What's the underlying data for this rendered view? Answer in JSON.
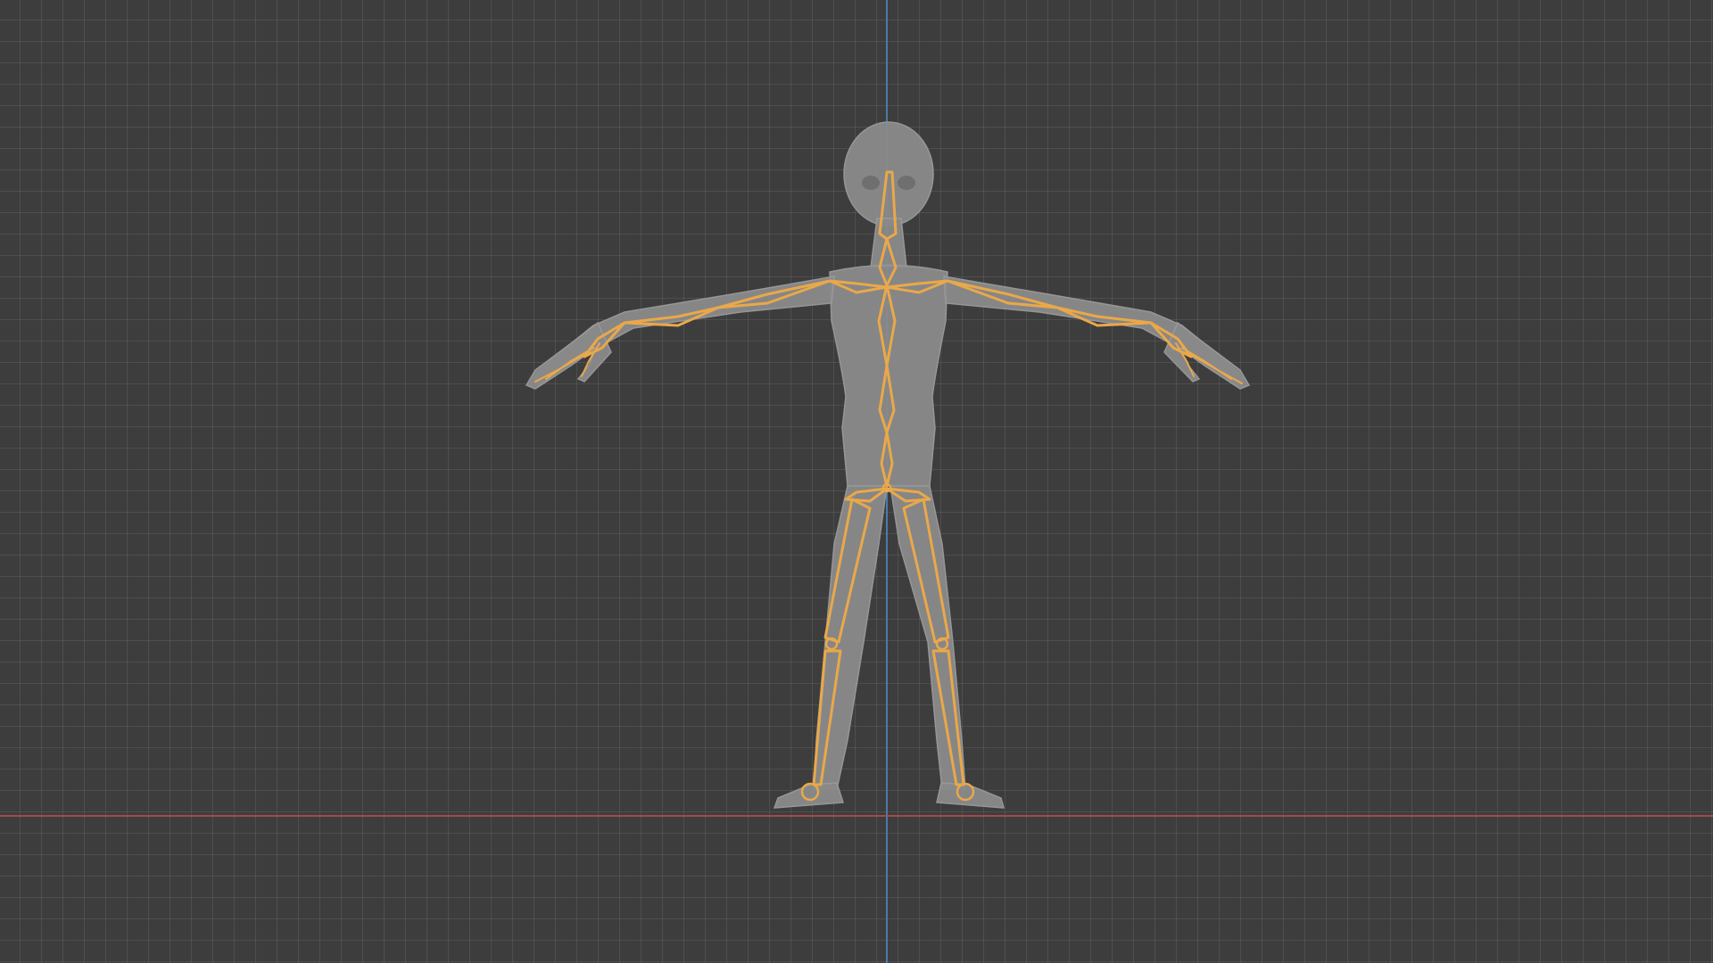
{
  "viewport": {
    "mode": "front-orthographic",
    "grid_visible": true,
    "axes_visible": [
      "x",
      "z"
    ]
  },
  "colors": {
    "background": "#3d3d3d",
    "grid_line": "#505050",
    "x_axis": "#b34b4b",
    "z_axis": "#4f7fb6",
    "mesh": "#8a8a8a",
    "armature_selected": "#e9a84a"
  },
  "scene": {
    "mesh_object": "humanoid-character-mesh",
    "armature_object": "humanoid-armature",
    "pose": "T-pose",
    "armature_selected": true
  }
}
